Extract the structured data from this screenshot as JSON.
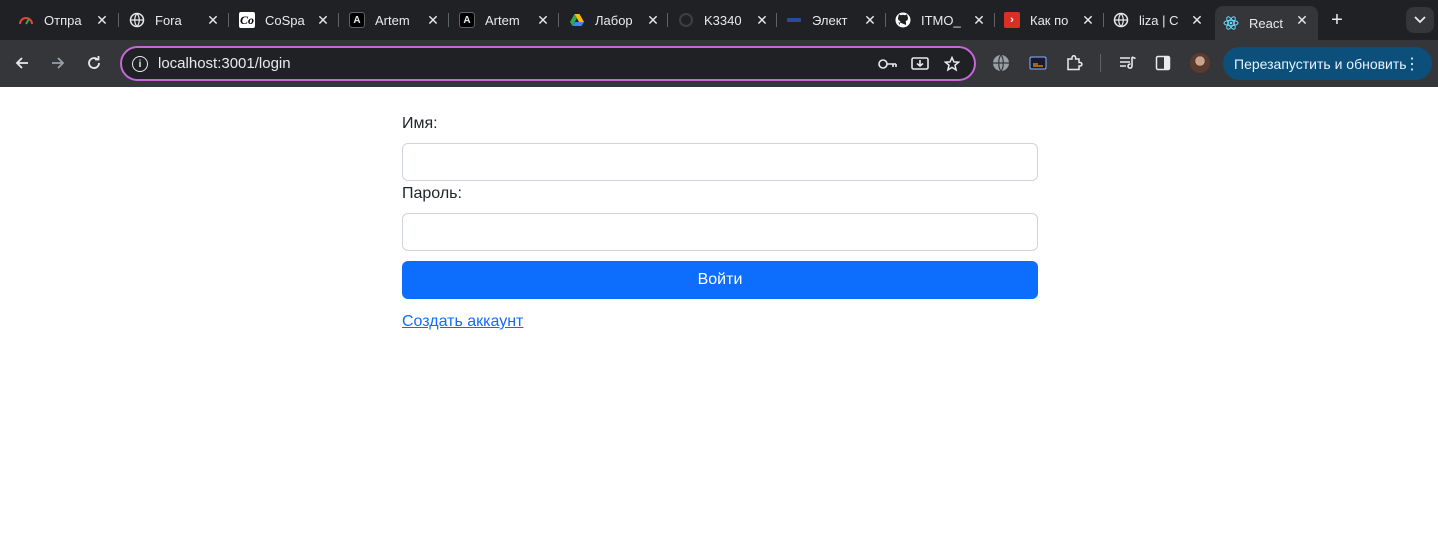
{
  "browser": {
    "tabs": [
      {
        "title": "Отпра",
        "icon": "gauge-icon",
        "active": false
      },
      {
        "title": "Fora",
        "icon": "globe-icon",
        "active": false
      },
      {
        "title": "CoSpa",
        "icon": "cospace-icon",
        "active": false
      },
      {
        "title": "Artem",
        "icon": "letter-a-icon",
        "active": false
      },
      {
        "title": "Artem",
        "icon": "letter-a-icon",
        "active": false
      },
      {
        "title": "Лабор",
        "icon": "google-drive-icon",
        "active": false
      },
      {
        "title": "K3340",
        "icon": "loading-icon",
        "active": false
      },
      {
        "title": "Элект",
        "icon": "site-icon",
        "active": false
      },
      {
        "title": "ITMO_",
        "icon": "github-icon",
        "active": false
      },
      {
        "title": "Как по",
        "icon": "arrow-badge-icon",
        "active": false
      },
      {
        "title": "liza | C",
        "icon": "globe-icon",
        "active": false
      },
      {
        "title": "React",
        "icon": "react-icon",
        "active": true
      }
    ],
    "url": "localhost:3001/login",
    "update_button_label": "Перезапустить и обновить"
  },
  "login": {
    "name_label": "Имя:",
    "name_value": "",
    "password_label": "Пароль:",
    "password_value": "",
    "submit_label": "Войти",
    "register_link": "Создать аккаунт"
  },
  "colors": {
    "primary": "#0d6efd",
    "omnibox_focus": "#c667d9",
    "update_button": "#0b4f7a"
  }
}
